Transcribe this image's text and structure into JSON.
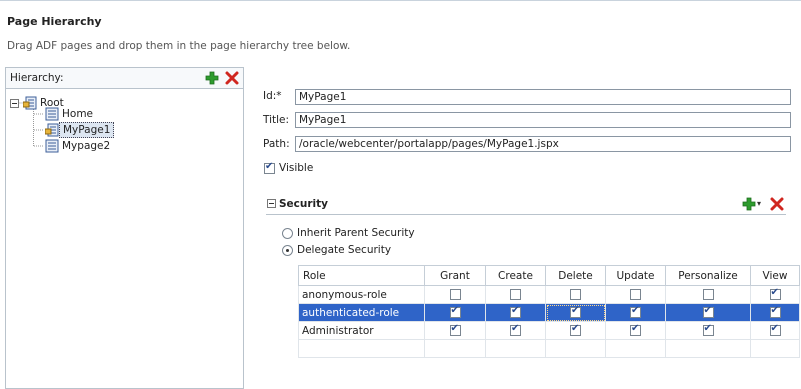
{
  "page": {
    "title": "Page Hierarchy",
    "instructions": "Drag ADF pages and drop them in the page hierarchy tree below."
  },
  "hierarchy": {
    "label": "Hierarchy:",
    "tree": [
      {
        "label": "Root",
        "expanded": true,
        "icon": "secured-page-icon"
      },
      {
        "label": "Home",
        "icon": "page-icon"
      },
      {
        "label": "MyPage1",
        "icon": "secured-page-icon",
        "selected": true
      },
      {
        "label": "Mypage2",
        "icon": "page-icon"
      }
    ]
  },
  "details": {
    "id_label": "Id:*",
    "id_value": "MyPage1",
    "title_label": "Title:",
    "title_value": "MyPage1",
    "path_label": "Path:",
    "path_value": "/oracle/webcenter/portalapp/pages/MyPage1.jspx",
    "visible_label": "Visible",
    "visible_checked": true
  },
  "security": {
    "header": "Security",
    "inherit_label": "Inherit Parent Security",
    "delegate_label": "Delegate Security",
    "selected_option": "delegate",
    "columns": [
      "Role",
      "Grant",
      "Create",
      "Delete",
      "Update",
      "Personalize",
      "View"
    ],
    "rows": [
      {
        "role": "anonymous-role",
        "perms": [
          false,
          false,
          false,
          false,
          false,
          true
        ],
        "selected": false
      },
      {
        "role": "authenticated-role",
        "perms": [
          true,
          true,
          true,
          true,
          true,
          true
        ],
        "selected": true
      },
      {
        "role": "Administrator",
        "perms": [
          true,
          true,
          true,
          true,
          true,
          true
        ],
        "selected": false
      }
    ]
  },
  "colors": {
    "accent_selection": "#2f64c8",
    "add_icon": "#2e9c2e",
    "delete_icon": "#d0261f"
  }
}
